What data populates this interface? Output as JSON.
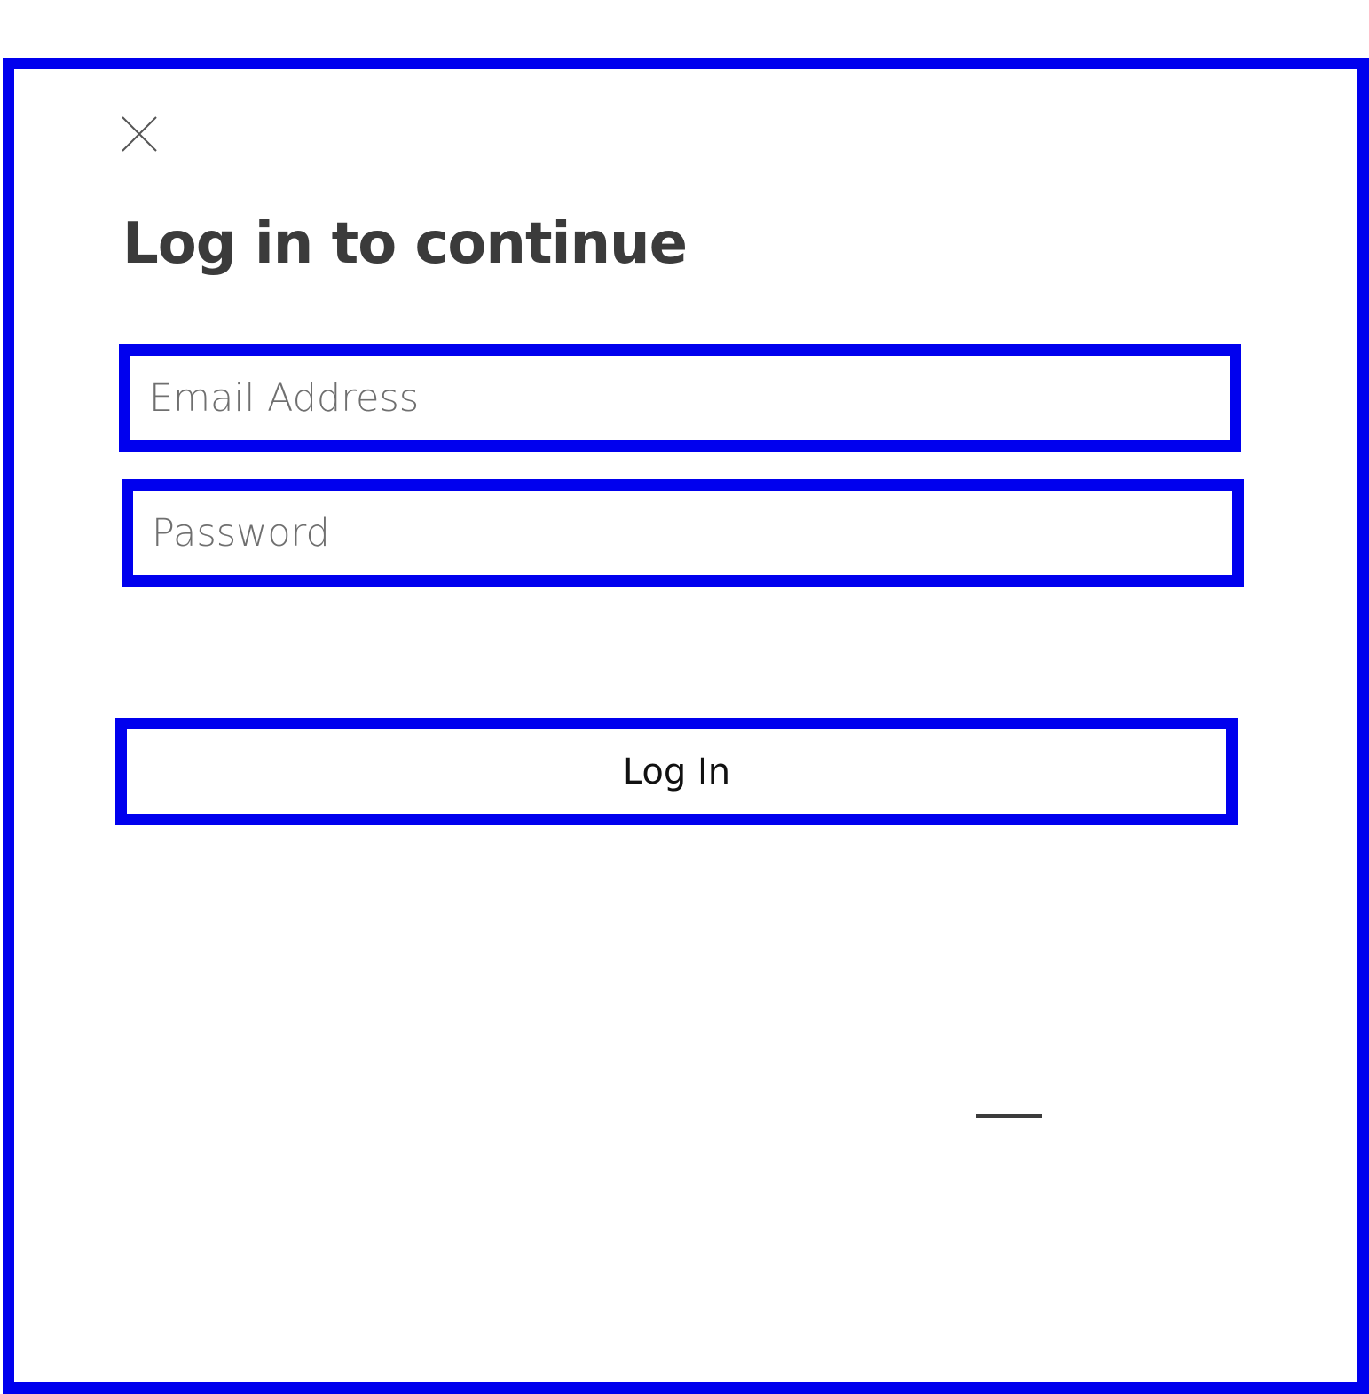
{
  "dialog": {
    "close_icon": "close-icon",
    "title": "Log in to continue",
    "email": {
      "placeholder": "Email Address",
      "value": ""
    },
    "password": {
      "placeholder": "Password",
      "value": ""
    },
    "login_button": {
      "label": "Log In"
    }
  },
  "colors": {
    "outline": "#0000ee",
    "text": "#3b3b3b",
    "placeholder": "#6f6f6f",
    "background": "#ffffff"
  }
}
